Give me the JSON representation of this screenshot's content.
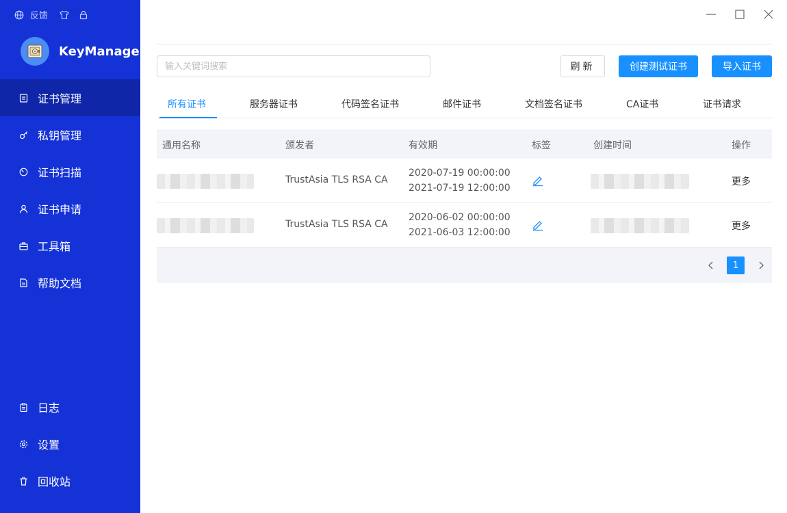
{
  "app": {
    "name": "KeyManager"
  },
  "topbar": {
    "feedback": "反馈"
  },
  "nav": {
    "items": [
      {
        "label": "证书管理",
        "icon": "certificate-icon",
        "active": true
      },
      {
        "label": "私钥管理",
        "icon": "key-icon"
      },
      {
        "label": "证书扫描",
        "icon": "scan-icon"
      },
      {
        "label": "证书申请",
        "icon": "user-icon"
      },
      {
        "label": "工具箱",
        "icon": "toolbox-icon"
      },
      {
        "label": "帮助文档",
        "icon": "document-icon"
      }
    ],
    "bottom": [
      {
        "label": "日志",
        "icon": "clipboard-icon"
      },
      {
        "label": "设置",
        "icon": "gear-icon"
      },
      {
        "label": "回收站",
        "icon": "trash-icon"
      }
    ]
  },
  "toolbar": {
    "search_placeholder": "输入关键词搜索",
    "refresh_label": "刷新",
    "create_test_label": "创建测试证书",
    "import_label": "导入证书"
  },
  "tabs": [
    "所有证书",
    "服务器证书",
    "代码签名证书",
    "邮件证书",
    "文档签名证书",
    "CA证书",
    "证书请求"
  ],
  "table": {
    "columns": [
      "通用名称",
      "颁发者",
      "有效期",
      "标签",
      "创建时间",
      "操作"
    ],
    "rows": [
      {
        "issuer": "TrustAsia TLS RSA CA",
        "valid_from": "2020-07-19 00:00:00",
        "valid_to": "2021-07-19 12:00:00",
        "action": "更多"
      },
      {
        "issuer": "TrustAsia TLS RSA CA",
        "valid_from": "2020-06-02 00:00:00",
        "valid_to": "2021-06-03 12:00:00",
        "action": "更多"
      }
    ]
  },
  "pagination": {
    "current": "1"
  },
  "colors": {
    "sidebar": "#1432d6",
    "sidebar_active": "#0f26a8",
    "accent": "#1890ff"
  }
}
